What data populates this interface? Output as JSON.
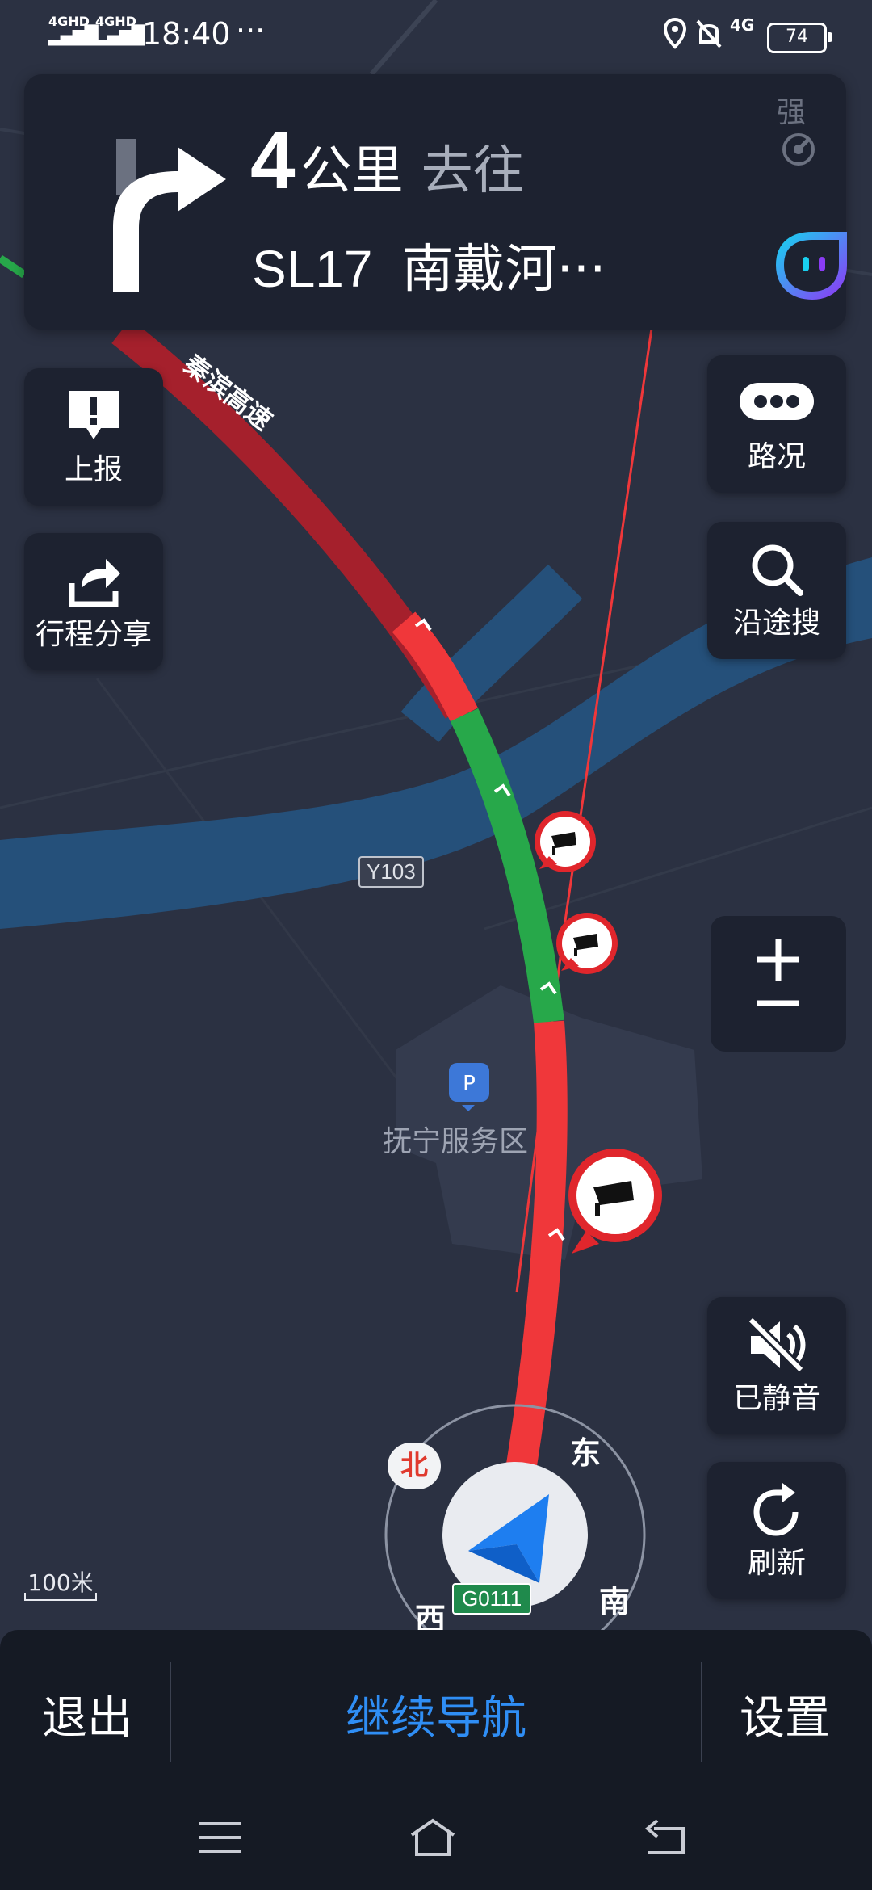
{
  "status_bar": {
    "network1": "4GHD",
    "network2": "4GHD",
    "time": "18:40",
    "more": "···",
    "network3": "4G",
    "battery": "74"
  },
  "guidance": {
    "distance_value": "4",
    "distance_unit": "公里",
    "toward": "去往",
    "road_code": "SL17",
    "road_name": "南戴河···",
    "signal_label": "强"
  },
  "left_controls": {
    "report_label": "上报",
    "share_label": "行程分享"
  },
  "right_controls": {
    "traffic_label": "路况",
    "search_label": "沿途搜",
    "mute_label": "已静音",
    "refresh_label": "刷新"
  },
  "map": {
    "highway_name": "秦滨高速",
    "road_badge": "Y103",
    "poi_name": "抚宁服务区",
    "route_badge": "G0111",
    "scale": "100米",
    "compass": {
      "north": "北",
      "east": "东",
      "south": "南",
      "west": "西"
    }
  },
  "bottom_bar": {
    "exit_label": "退出",
    "continue_label": "继续导航",
    "settings_label": "设置"
  },
  "colors": {
    "route_red": "#f0373a",
    "route_green": "#27a84a",
    "route_darkred": "#a5202c",
    "accent_blue": "#2f8ef5"
  }
}
